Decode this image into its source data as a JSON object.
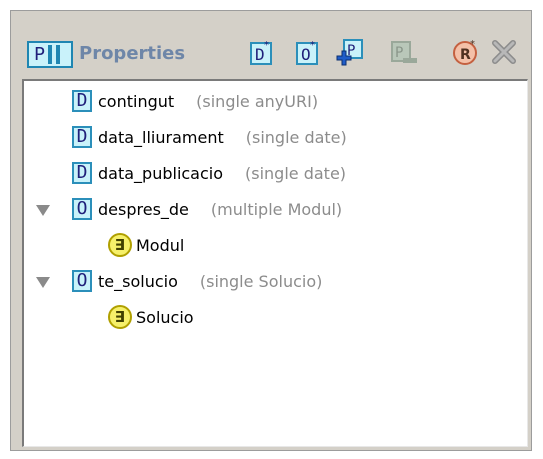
{
  "header": {
    "badge_letter": "P",
    "title": "Properties"
  },
  "toolbar": {
    "icons": [
      "add-datatype-property-icon",
      "add-object-property-icon",
      "create-property-icon",
      "delete-property-icon",
      "restriction-icon",
      "remove-icon"
    ]
  },
  "properties": [
    {
      "icon": "D",
      "name": "contingut",
      "type": "(single anyURI)"
    },
    {
      "icon": "D",
      "name": "data_lliurament",
      "type": "(single date)"
    },
    {
      "icon": "D",
      "name": "data_publicacio",
      "type": "(single date)"
    },
    {
      "icon": "O",
      "name": "despres_de",
      "type": "(multiple Modul)",
      "expanded": true,
      "children": [
        {
          "icon": "∃",
          "name": "Modul"
        }
      ]
    },
    {
      "icon": "O",
      "name": "te_solucio",
      "type": "(single Solucio)",
      "expanded": true,
      "children": [
        {
          "icon": "∃",
          "name": "Solucio"
        }
      ]
    }
  ],
  "colors": {
    "panel_bg": "#d4d0c8",
    "icon_fill": "#c9f2fa",
    "icon_border": "#2b8fba",
    "type_text": "#8c8c8c",
    "title_text": "#6e86a8",
    "exists_fill": "#f6f06a"
  }
}
